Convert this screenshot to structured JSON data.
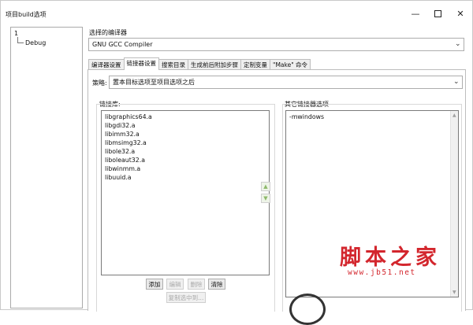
{
  "window": {
    "title": "项目build选项",
    "minimize_glyph": "—",
    "close_glyph": "✕"
  },
  "tree": {
    "root": "1",
    "child": "Debug"
  },
  "compiler": {
    "label": "选择的编译器",
    "value": "GNU GCC Compiler"
  },
  "tabs": [
    {
      "label": "编译器设置"
    },
    {
      "label": "链接器设置"
    },
    {
      "label": "搜索目录"
    },
    {
      "label": "生成前后附加步骤"
    },
    {
      "label": "定制变量"
    },
    {
      "label": "\"Make\" 命令"
    }
  ],
  "policy": {
    "label": "策略:",
    "value": "置本目标选项至项目选项之后"
  },
  "link_libraries": {
    "label": "链接库:",
    "items": [
      "libgraphics64.a",
      "libgdi32.a",
      "libimm32.a",
      "libmsimg32.a",
      "libole32.a",
      "liboleaut32.a",
      "libwinmm.a",
      "libuuid.a"
    ],
    "buttons": {
      "add": "添加",
      "edit": "编辑",
      "delete": "删除",
      "clear": "清除",
      "copy_selected": "复制选中到..."
    }
  },
  "other_options": {
    "label": "其它链接器选项",
    "value": "-mwindows"
  },
  "watermark": {
    "text": "脚本之家",
    "url": "www.jb51.net"
  }
}
